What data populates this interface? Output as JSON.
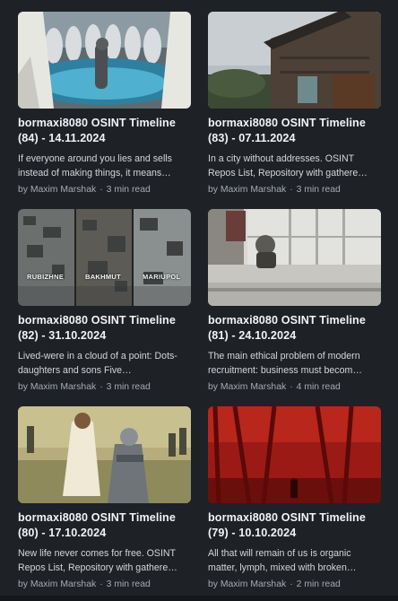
{
  "cards": [
    {
      "title": "bormaxi8080 OSINT Timeline (84) - 14.11.2024",
      "excerpt": "If everyone around you lies and sells instead of making things, it means…",
      "author": "by Maxim Marshak",
      "read_time": "3 min read",
      "image": "baptism-pool-icon"
    },
    {
      "title": "bormaxi8080 OSINT Timeline (83) - 07.11.2024",
      "excerpt": "In a city without addresses. OSINT Repos List, Repository with gathere…",
      "author": "by Maxim Marshak",
      "read_time": "3 min read",
      "image": "wooden-house-icon"
    },
    {
      "title": "bormaxi8080 OSINT Timeline (82) - 31.10.2024",
      "excerpt": "Lived-were in a cloud of a point: Dots-daughters and sons Five…",
      "author": "by Maxim Marshak",
      "read_time": "3 min read",
      "image": "ruined-cities-icon",
      "labels": [
        "RUBIZHNE",
        "BAKHMUT",
        "MARIUPOL"
      ]
    },
    {
      "title": "bormaxi8080 OSINT Timeline (81) - 24.10.2024",
      "excerpt": "The main ethical problem of modern recruitment: business must becom…",
      "author": "by Maxim Marshak",
      "read_time": "4 min read",
      "image": "balcony-gasmask-icon"
    },
    {
      "title": "bormaxi8080 OSINT Timeline (80) - 17.10.2024",
      "excerpt": "New life never comes for free. OSINT Repos List, Repository with gathere…",
      "author": "by Maxim Marshak",
      "read_time": "3 min read",
      "image": "jesus-robot-river-icon"
    },
    {
      "title": "bormaxi8080 OSINT Timeline (79) - 10.10.2024",
      "excerpt": "All that will remain of us is organic matter, lymph, mixed with broken…",
      "author": "by Maxim Marshak",
      "read_time": "2 min read",
      "image": "red-forest-icon"
    }
  ]
}
